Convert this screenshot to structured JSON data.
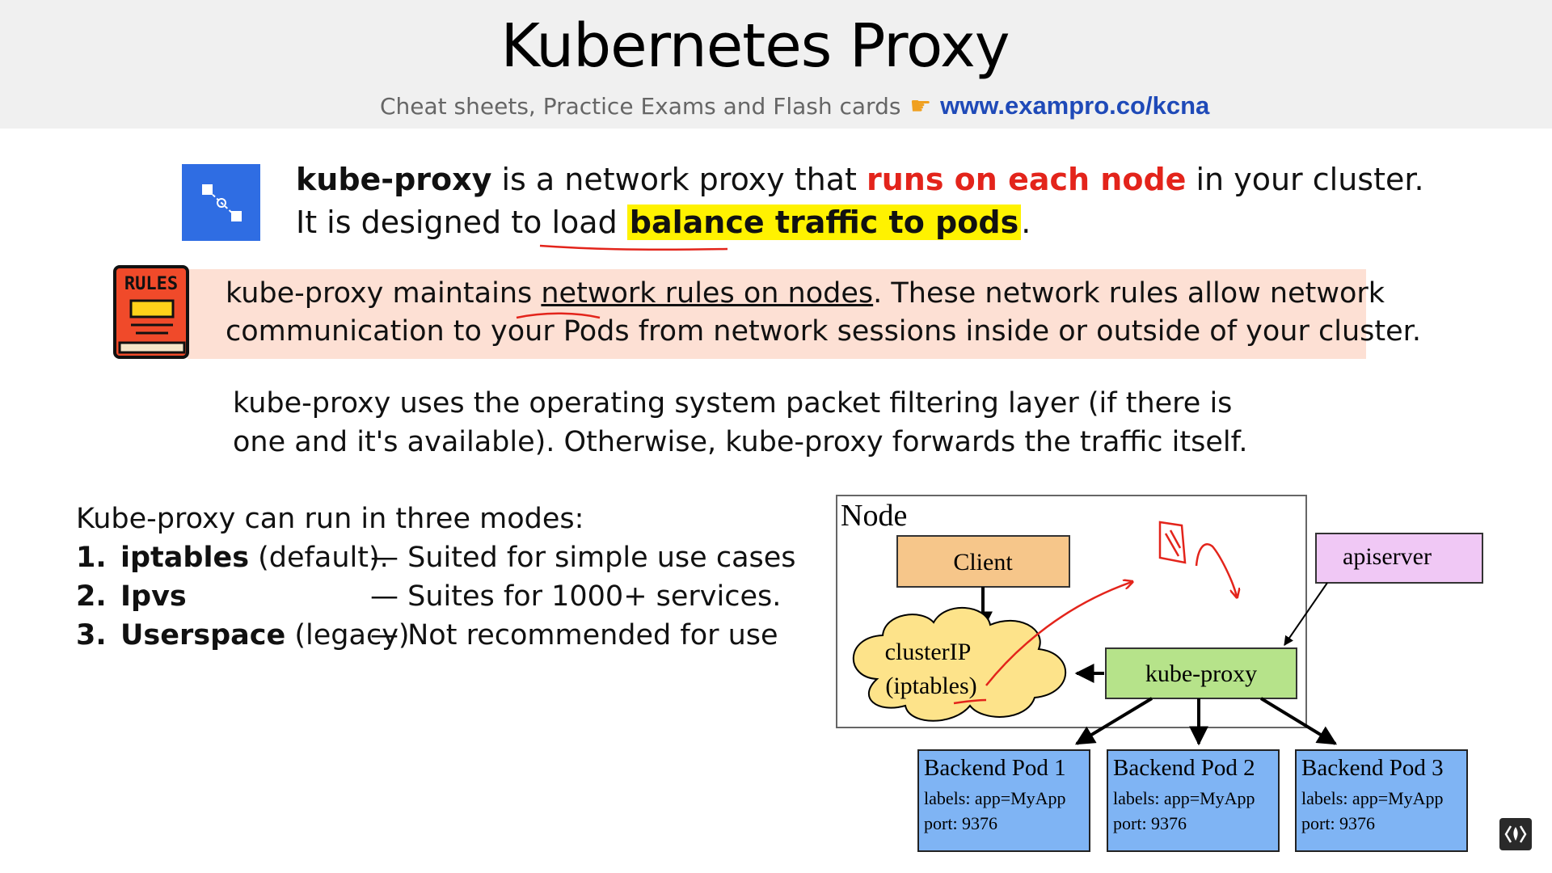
{
  "header": {
    "title": "Kubernetes Proxy",
    "subtitle": "Cheat sheets, Practice Exams and Flash cards",
    "link": "www.exampro.co/kcna"
  },
  "intro": {
    "term": "kube-proxy",
    "text_a": " is a network proxy that ",
    "highlight_red": "runs on each node",
    "text_b": " in your cluster.",
    "line2_a": "It is designed to load ",
    "highlight_yellow": "balance traffic to pods",
    "line2_b": "."
  },
  "rules": {
    "icon_label": "RULES",
    "line1_a": "kube-proxy maintains ",
    "line1_underline": "network rules on nodes",
    "line1_b": ".  These network rules allow network",
    "line2": "communication to your Pods from network sessions inside or outside of your cluster."
  },
  "filtering": {
    "line1": "kube-proxy uses the operating system packet filtering layer (if there is",
    "line2": "one and it's available). Otherwise, kube-proxy forwards the traffic itself."
  },
  "modes": {
    "intro": "Kube-proxy can run in three modes:",
    "items": [
      {
        "num": "1.",
        "name": "iptables",
        "suffix": " (default).",
        "desc": "— Suited for simple use cases"
      },
      {
        "num": "2.",
        "name": "Ipvs",
        "suffix": "",
        "desc": "— Suites for 1000+ services."
      },
      {
        "num": "3.",
        "name": "Userspace",
        "suffix": " (legacy)",
        "desc": "— Not recommended for use"
      }
    ]
  },
  "diagram": {
    "node_label": "Node",
    "client": "Client",
    "cluster_ip_line1": "clusterIP",
    "cluster_ip_line2": "(iptables)",
    "kube_proxy": "kube-proxy",
    "apiserver": "apiserver",
    "pods": [
      {
        "title": "Backend Pod 1",
        "labels": "labels: app=MyApp",
        "port": "port: 9376"
      },
      {
        "title": "Backend Pod 2",
        "labels": "labels: app=MyApp",
        "port": "port: 9376"
      },
      {
        "title": "Backend Pod 3",
        "labels": "labels: app=MyApp",
        "port": "port: 9376"
      }
    ]
  },
  "colors": {
    "accent_blue": "#2f6de3",
    "highlight_red": "#e3241b",
    "highlight_yellow": "#fff200",
    "rules_band": "#fde0d4",
    "client_fill": "#f6c68a",
    "cloud_fill": "#fde38a",
    "kube_proxy_fill": "#b6e38a",
    "apiserver_fill": "#f0c8f5",
    "pod_fill": "#7fb4f4"
  }
}
